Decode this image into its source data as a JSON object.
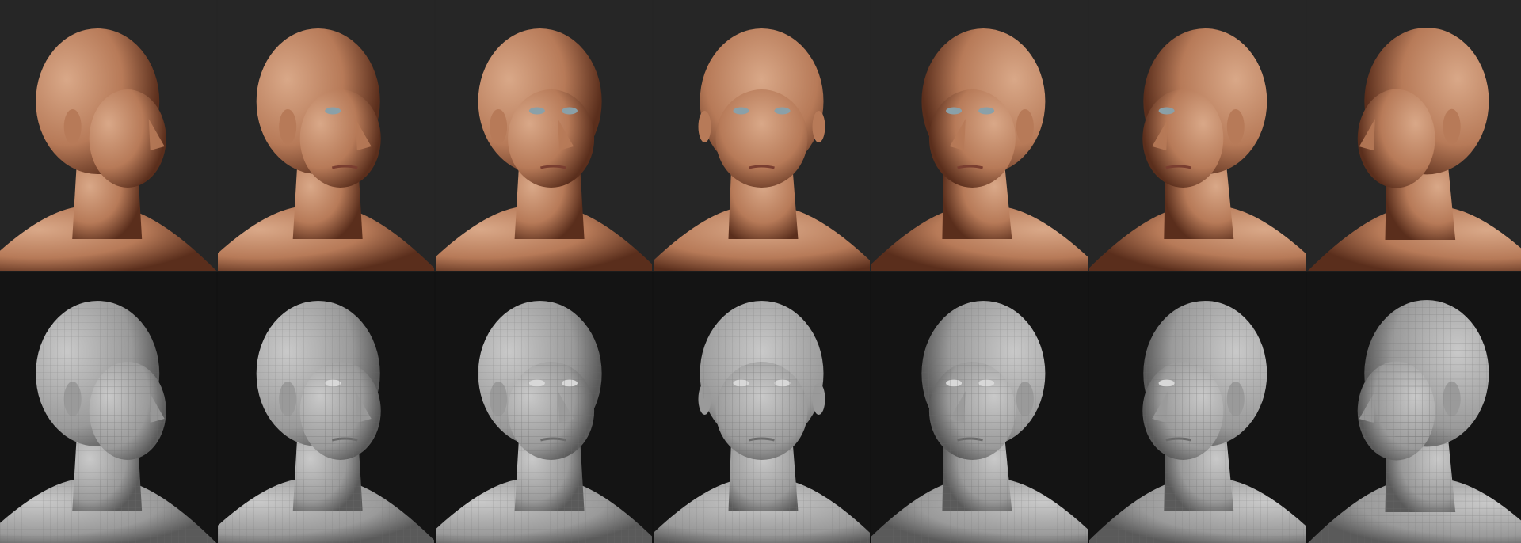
{
  "image": {
    "description_free": true,
    "rows": [
      {
        "kind": "textured",
        "panels": [
          {
            "view": "back-three-quarter-right"
          },
          {
            "view": "right-three-quarter"
          },
          {
            "view": "front-right-three-quarter"
          },
          {
            "view": "front"
          },
          {
            "view": "front-left-three-quarter"
          },
          {
            "view": "left-three-quarter"
          },
          {
            "view": "back-three-quarter-left"
          }
        ]
      },
      {
        "kind": "wireframe",
        "panels": [
          {
            "view": "back-three-quarter-right"
          },
          {
            "view": "right-three-quarter"
          },
          {
            "view": "front-right-three-quarter"
          },
          {
            "view": "front"
          },
          {
            "view": "front-left-three-quarter"
          },
          {
            "view": "left-three-quarter"
          },
          {
            "view": "back-three-quarter-left"
          }
        ]
      }
    ]
  },
  "colors": {
    "background": "#1c1c1c",
    "textured_panel_bg": "#262626",
    "wire_panel_bg": "#141414",
    "skin_light": "#d9a888",
    "skin_mid": "#b77a58",
    "skin_dark": "#5a2e1c",
    "mesh_light": "#c9c9c9",
    "mesh_mid": "#9a9a9a",
    "mesh_line": "#6e6e6e"
  }
}
